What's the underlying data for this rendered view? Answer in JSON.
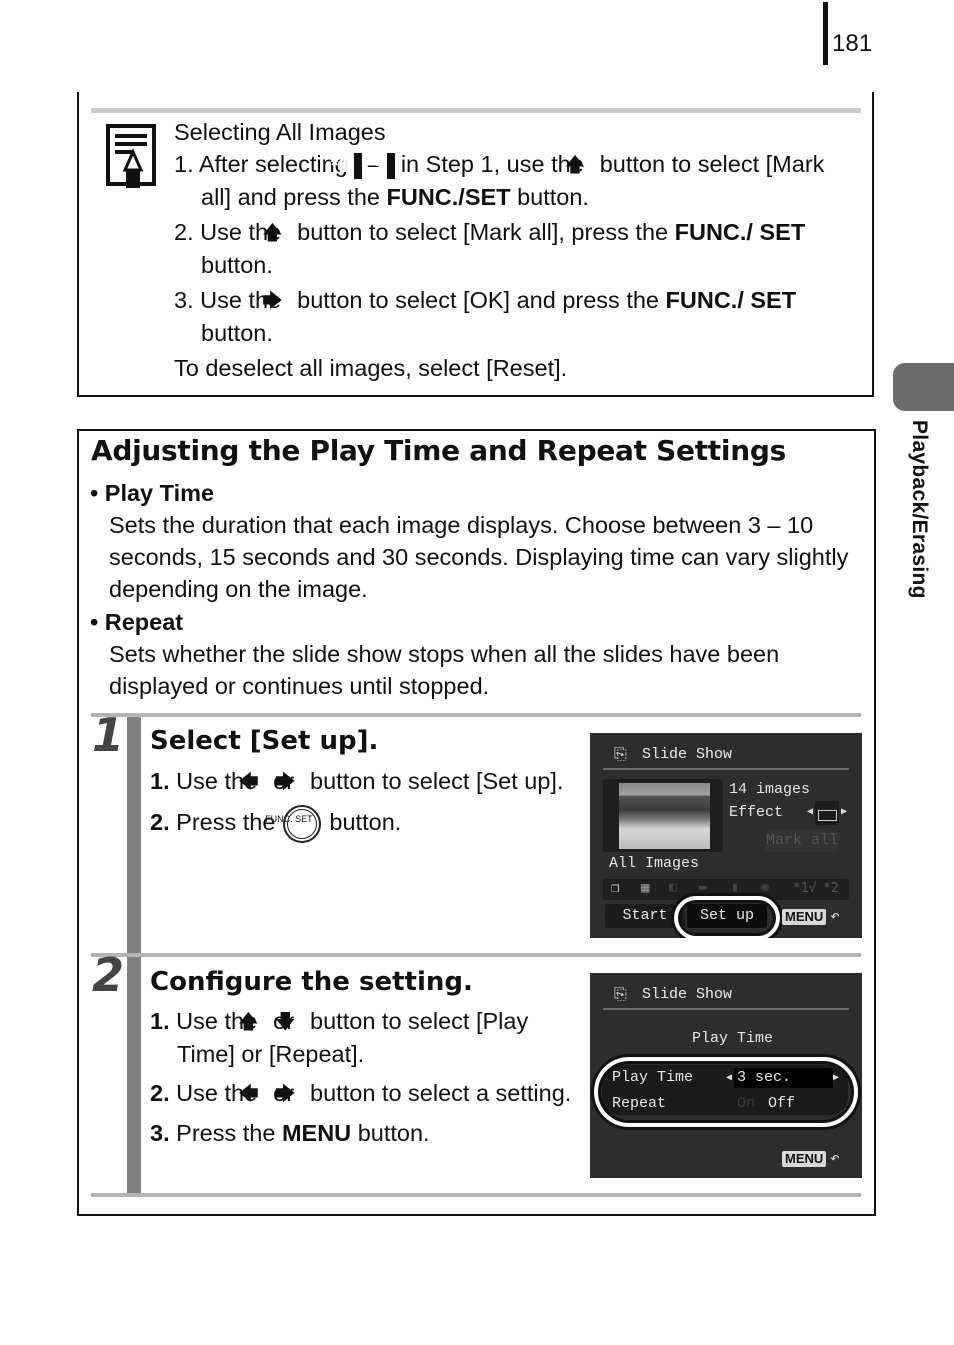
{
  "page_number": "181",
  "side_tab": "Playback/Erasing",
  "note": {
    "icon": "memo-pencil-icon",
    "title": "Selecting All Images",
    "item1": {
      "num": "1.",
      "pre": "After selecting",
      "key_from": "*1",
      "dash": "–",
      "key_to": "*3",
      "mid": "in Step 1, use the",
      "arrow": "up-arrow",
      "post": "button to select [Mark all] and press the",
      "bold": "FUNC./SET",
      "end": "button."
    },
    "item2": {
      "num": "2.",
      "pre": "Use the",
      "arrow": "up-arrow",
      "post": "button to select [Mark all], press the",
      "bold": "FUNC./ SET",
      "end": "button."
    },
    "item3": {
      "num": "3.",
      "pre": "Use the",
      "arrow": "right-arrow",
      "post": "button to select [OK] and press the",
      "bold": "FUNC./ SET",
      "end": "button."
    },
    "footer": "To deselect all images, select [Reset]."
  },
  "section": {
    "title": "Adjusting the Play Time and Repeat Settings",
    "bullets": [
      {
        "heading": "Play Time",
        "text": "Sets the duration that each image displays. Choose between 3 – 10 seconds, 15 seconds and 30 seconds. Displaying time can vary slightly depending on the image."
      },
      {
        "heading": "Repeat",
        "text": "Sets whether the slide show stops when all the slides have been displayed or continues until stopped."
      }
    ]
  },
  "step1": {
    "number": "1",
    "title": "Select [Set up].",
    "items": [
      {
        "num": "1.",
        "pre": "Use the",
        "a1": "left-arrow",
        "or": "or",
        "a2": "right-arrow",
        "post": "button to select [Set up]."
      },
      {
        "num": "2.",
        "pre": "Press the",
        "button": "FUNC. SET",
        "post": "button."
      }
    ],
    "screen": {
      "title": "Slide Show",
      "count": "14 images",
      "effect_label": "Effect",
      "mark_all": "Mark all",
      "mode": "All Images",
      "icons": [
        "all-images",
        "date",
        "category",
        "folder",
        "movie",
        "camera",
        "*1√",
        "*2"
      ],
      "start": "Start",
      "setup": "Set up",
      "menu": "MENU"
    }
  },
  "step2": {
    "number": "2",
    "title": "Configure the setting.",
    "items": [
      {
        "num": "1.",
        "pre": "Use the",
        "a1": "up-arrow",
        "or": "or",
        "a2": "down-arrow",
        "post": "button to select [Play Time] or [Repeat]."
      },
      {
        "num": "2.",
        "pre": "Use the",
        "a1": "left-arrow",
        "or": "or",
        "a2": "right-arrow",
        "post": "button to select a setting."
      },
      {
        "num": "3.",
        "pre": "Press the",
        "bold": "MENU",
        "post": "button."
      }
    ],
    "screen": {
      "title": "Slide Show",
      "subtitle": "Play Time",
      "row1_label": "Play Time",
      "row1_value": "3 sec.",
      "row2_label": "Repeat",
      "row2_on": "On",
      "row2_off": "Off",
      "menu": "MENU"
    }
  }
}
